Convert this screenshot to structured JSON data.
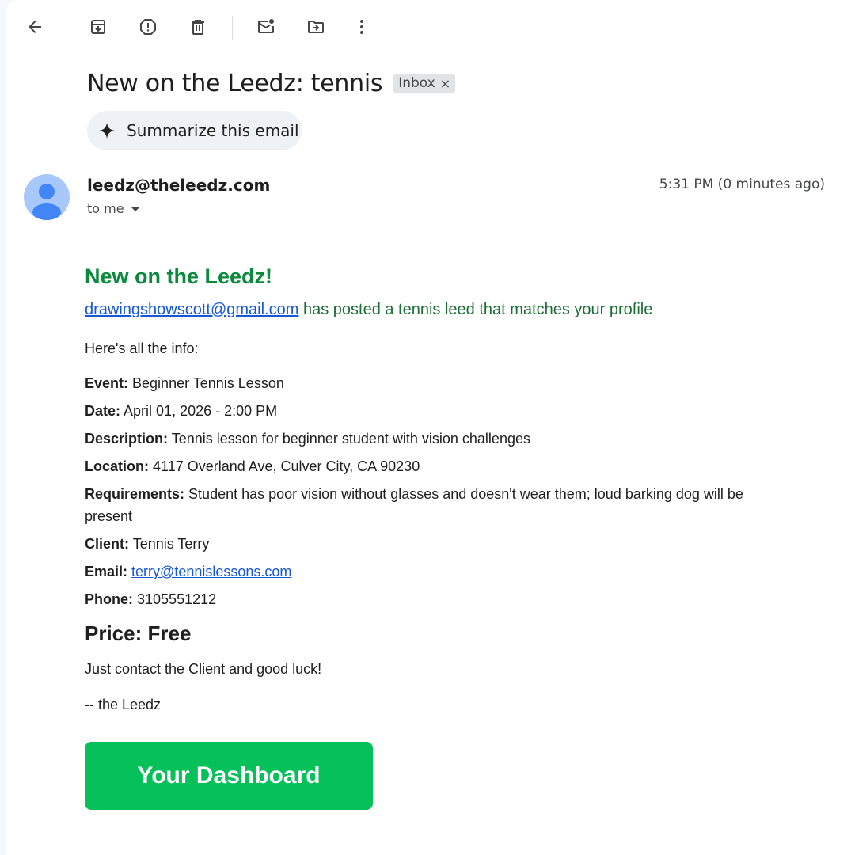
{
  "toolbar": {
    "icons": [
      "back-arrow-icon",
      "archive-icon",
      "report-spam-icon",
      "delete-icon",
      "mark-unread-icon",
      "move-to-icon",
      "more-vert-icon"
    ]
  },
  "email": {
    "subject": "New on the Leedz: tennis",
    "label": "Inbox",
    "label_remove": "×",
    "summarize_label": "Summarize this email",
    "sender": "leedz@theleedz.com",
    "recipient": "to me",
    "timestamp": "5:31 PM (0 minutes ago)"
  },
  "body": {
    "heading": "New on the Leedz!",
    "poster_email": "drawingshowscott@gmail.com",
    "intro_rest": " has posted a tennis leed that matches your profile",
    "here_info": "Here's all the info:",
    "fields": [
      {
        "label": "Event:",
        "value": "Beginner Tennis Lesson"
      },
      {
        "label": "Date:",
        "value": "April 01, 2026 - 2:00 PM"
      },
      {
        "label": "Description:",
        "value": "Tennis lesson for beginner student with vision challenges"
      },
      {
        "label": "Location:",
        "value": "4117 Overland Ave, Culver City, CA 90230"
      },
      {
        "label": "Requirements:",
        "value": "Student has poor vision without glasses and doesn't wear them; loud barking dog will be present"
      },
      {
        "label": "Client:",
        "value": "Tennis Terry"
      },
      {
        "label": "Email:",
        "value": "terry@tennislessons.com"
      },
      {
        "label": "Phone:",
        "value": "3105551212"
      }
    ],
    "price": "Price: Free",
    "contact": "Just contact the Client and good luck!",
    "signature": "-- the Leedz",
    "dashboard_button": "Your Dashboard"
  },
  "colors": {
    "heading_green": "#0b8a3e",
    "intro_green": "#1b6e36",
    "link_blue": "#1558d6",
    "button_green": "#06c05a",
    "avatar_bg": "#a8c7fa",
    "avatar_fg": "#4285f4"
  }
}
